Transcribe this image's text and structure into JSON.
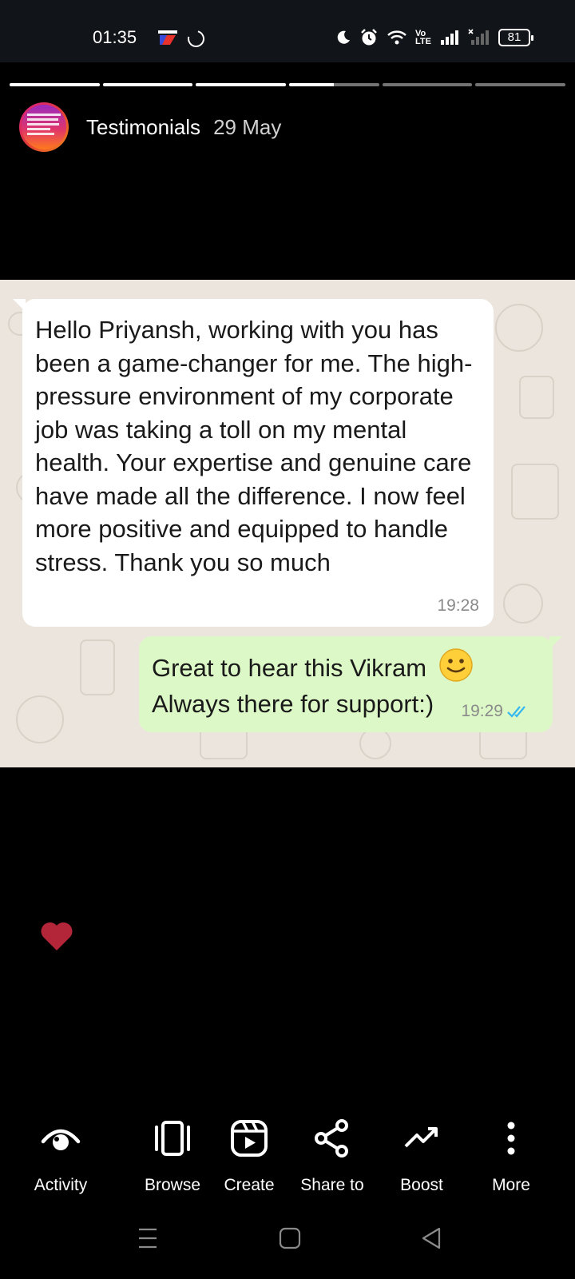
{
  "status_bar": {
    "time": "01:35",
    "app_icon": "sony-liv-icon",
    "volte_label_top": "Vo",
    "volte_label_bottom": "LTE",
    "battery": "81"
  },
  "story": {
    "segments": 6,
    "current_segment_progress": 0.5,
    "account_name": "Testimonials",
    "date": "29 May"
  },
  "chat": {
    "incoming_message": "Hello Priyansh, working with you has been a game-changer for me. The high-pressure environment of my corporate job was taking a toll on my mental health. Your expertise and genuine care have made all the difference. I now feel more positive and equipped to handle stress. Thank you so much",
    "incoming_time": "19:28",
    "outgoing_line1": "Great to hear this Vikram",
    "outgoing_line2": "Always there for support:)",
    "outgoing_time": "19:29",
    "read_receipt_color": "#34b7f1"
  },
  "actions": [
    {
      "label": "Activity",
      "icon": "eye-icon"
    },
    {
      "label": "Browse",
      "icon": "browse-icon"
    },
    {
      "label": "Create",
      "icon": "reel-icon"
    },
    {
      "label": "Share to",
      "icon": "share-icon"
    },
    {
      "label": "Boost",
      "icon": "trend-icon"
    },
    {
      "label": "More",
      "icon": "more-icon"
    }
  ],
  "colors": {
    "heart": "#b3263a",
    "chat_background": "#ece5dd",
    "outgoing_bubble": "#dcf8c6"
  }
}
